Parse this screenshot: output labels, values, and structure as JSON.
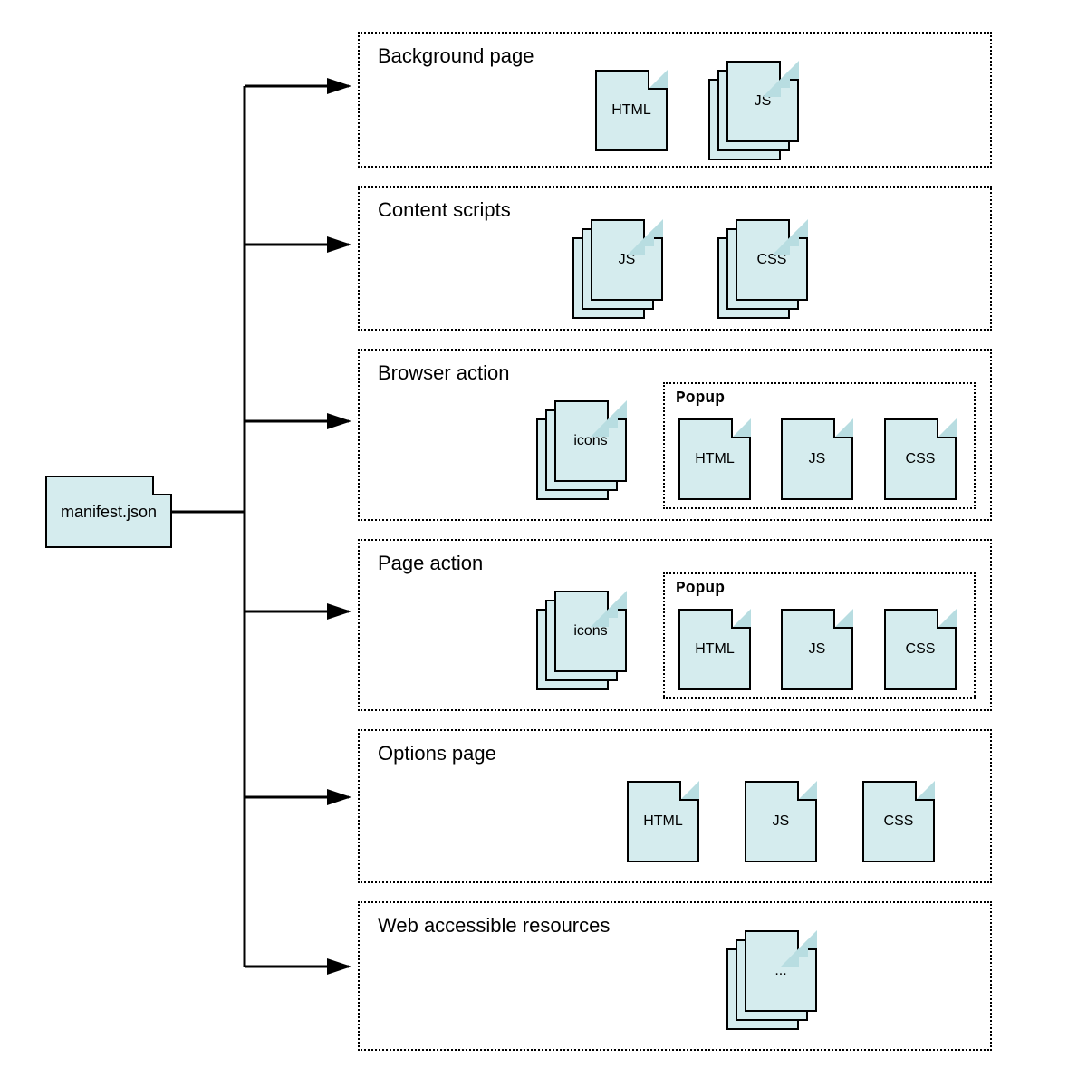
{
  "root": {
    "label": "manifest.json"
  },
  "sections": [
    {
      "title": "Background page",
      "files": [
        {
          "label": "HTML"
        },
        {
          "label": "JS",
          "stack": 3
        }
      ]
    },
    {
      "title": "Content scripts",
      "files": [
        {
          "label": "JS",
          "stack": 3
        },
        {
          "label": "CSS",
          "stack": 3
        }
      ]
    },
    {
      "title": "Browser action",
      "files": [
        {
          "label": "icons",
          "stack": 3
        }
      ],
      "popup": {
        "title": "Popup",
        "files": [
          {
            "label": "HTML"
          },
          {
            "label": "JS"
          },
          {
            "label": "CSS"
          }
        ]
      }
    },
    {
      "title": "Page action",
      "files": [
        {
          "label": "icons",
          "stack": 3
        }
      ],
      "popup": {
        "title": "Popup",
        "files": [
          {
            "label": "HTML"
          },
          {
            "label": "JS"
          },
          {
            "label": "CSS"
          }
        ]
      }
    },
    {
      "title": "Options page",
      "files": [
        {
          "label": "HTML"
        },
        {
          "label": "JS"
        },
        {
          "label": "CSS"
        }
      ]
    },
    {
      "title": "Web accessible resources",
      "files": [
        {
          "label": "...",
          "stack": 3
        }
      ]
    }
  ]
}
